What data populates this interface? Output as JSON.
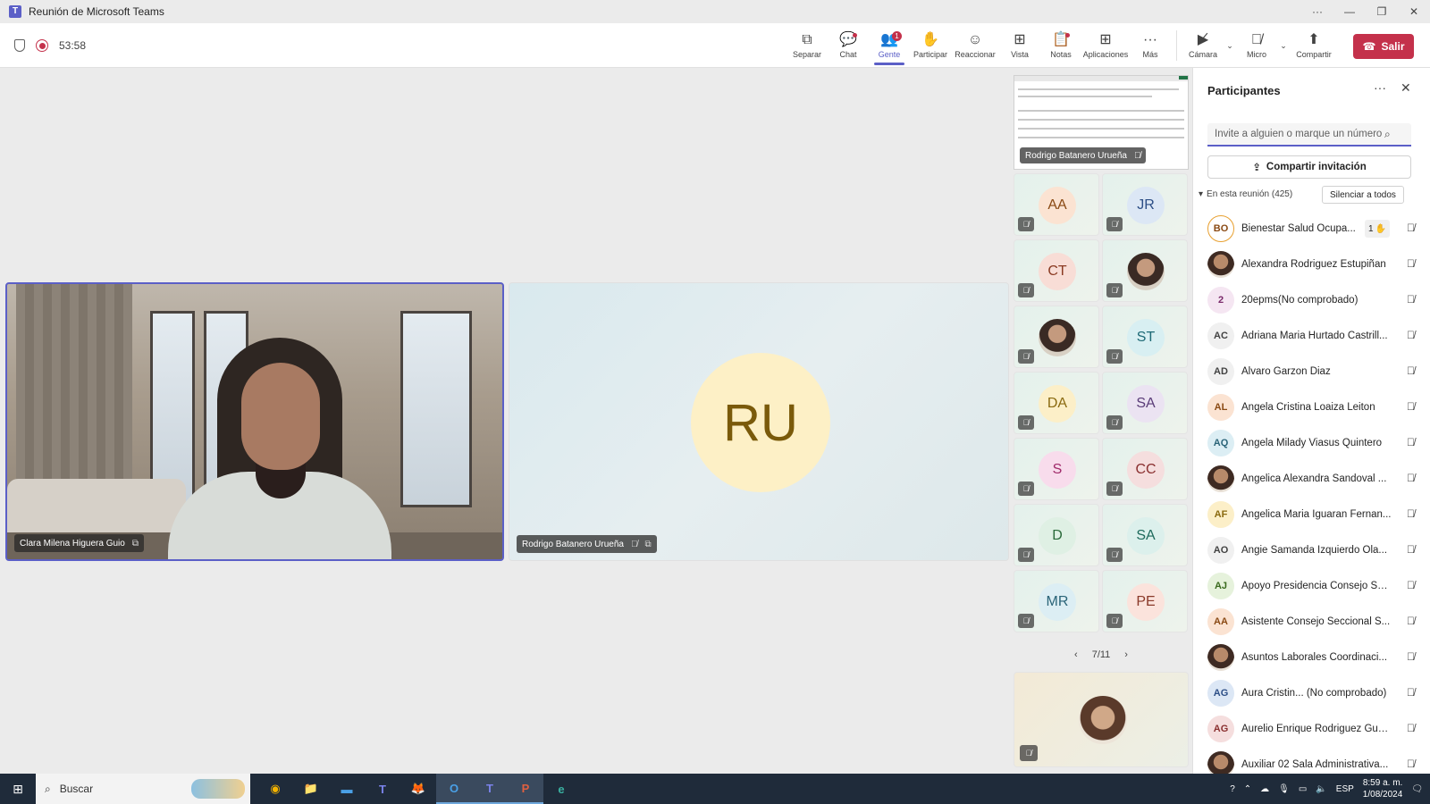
{
  "window": {
    "title": "Reunión de Microsoft Teams",
    "controls": [
      "···",
      "—",
      "❐",
      "✕"
    ]
  },
  "meeting": {
    "timer": "53:58"
  },
  "toolbar": {
    "items": [
      {
        "label": "Separar",
        "icon": "⧉"
      },
      {
        "label": "Chat",
        "icon": "💬"
      },
      {
        "label": "Gente",
        "icon": "👥",
        "badge": "1"
      },
      {
        "label": "Participar",
        "icon": "✋"
      },
      {
        "label": "Reaccionar",
        "icon": "☺"
      },
      {
        "label": "Vista",
        "icon": "⊞"
      },
      {
        "label": "Notas",
        "icon": "📋"
      },
      {
        "label": "Aplicaciones",
        "icon": "⊞"
      },
      {
        "label": "Más",
        "icon": "···"
      }
    ],
    "camera_label": "Cámara",
    "mic_label": "Micro",
    "share_label": "Compartir",
    "leave_label": "Salir"
  },
  "stage": {
    "clara_name": "Clara Milena Higuera Guio",
    "rodrigo_name": "Rodrigo Batanero Urueña",
    "rodrigo_initials": "RU"
  },
  "gallery": {
    "share_name": "Rodrigo Batanero Urueña",
    "tiles": [
      {
        "initials": "AA",
        "bg": "#fbe3d2",
        "fg": "#8a4a14"
      },
      {
        "initials": "JR",
        "bg": "#dce7f5",
        "fg": "#2c4e86"
      },
      {
        "initials": "CT",
        "bg": "#f8ddd6",
        "fg": "#8a3a22"
      },
      {
        "initials": "",
        "bg": "photo",
        "fg": ""
      },
      {
        "initials": "",
        "bg": "photo",
        "fg": ""
      },
      {
        "initials": "ST",
        "bg": "#d8eff2",
        "fg": "#1e6a76"
      },
      {
        "initials": "DA",
        "bg": "#fcefc8",
        "fg": "#8a6a10"
      },
      {
        "initials": "SA",
        "bg": "#ebe3f2",
        "fg": "#5a3c78"
      },
      {
        "initials": "S",
        "bg": "#f8dcec",
        "fg": "#a02a6a"
      },
      {
        "initials": "CC",
        "bg": "#f5dede",
        "fg": "#8a3030"
      },
      {
        "initials": "D",
        "bg": "#dff0e4",
        "fg": "#2a6a3a"
      },
      {
        "initials": "SA",
        "bg": "#dcf0ec",
        "fg": "#1e6a5c"
      },
      {
        "initials": "MR",
        "bg": "#dceef4",
        "fg": "#2a6478"
      },
      {
        "initials": "PE",
        "bg": "#fbe3dc",
        "fg": "#8a3a2a"
      }
    ],
    "pager": "7/11"
  },
  "participants": {
    "title": "Participantes",
    "search_placeholder": "Invite a alguien o marque un número",
    "invite_label": "Compartir invitación",
    "section_label": "En esta reunión (425)",
    "mute_all_label": "Silenciar a todos",
    "list": [
      {
        "initials": "BO",
        "name": "Bienestar Salud Ocupa...",
        "bg": "#fff",
        "fg": "#8a4a14",
        "hand": "1"
      },
      {
        "initials": "",
        "name": "Alexandra Rodriguez Estupiñan",
        "bg": "photo",
        "fg": ""
      },
      {
        "initials": "2",
        "name": "20epms(No comprobado)",
        "bg": "#f5e6f2",
        "fg": "#7a2a6a"
      },
      {
        "initials": "AC",
        "name": "Adriana Maria Hurtado Castrill...",
        "bg": "#f0f0f0",
        "fg": "#424242"
      },
      {
        "initials": "AD",
        "name": "Alvaro Garzon Diaz",
        "bg": "#f0f0f0",
        "fg": "#424242"
      },
      {
        "initials": "AL",
        "name": "Angela Cristina Loaiza Leiton",
        "bg": "#fbe3d2",
        "fg": "#8a4a14"
      },
      {
        "initials": "AQ",
        "name": "Angela Milady Viasus Quintero",
        "bg": "#dceef4",
        "fg": "#2a6478"
      },
      {
        "initials": "",
        "name": "Angelica Alexandra Sandoval ...",
        "bg": "photo",
        "fg": ""
      },
      {
        "initials": "AF",
        "name": "Angelica Maria Iguaran Fernan...",
        "bg": "#fcefc8",
        "fg": "#8a6a10"
      },
      {
        "initials": "AO",
        "name": "Angie Samanda Izquierdo Ola...",
        "bg": "#f0f0f0",
        "fg": "#424242"
      },
      {
        "initials": "AJ",
        "name": "Apoyo Presidencia Consejo Se...",
        "bg": "#e6f2dc",
        "fg": "#3a6a1e"
      },
      {
        "initials": "AA",
        "name": "Asistente Consejo Seccional S...",
        "bg": "#fbe3d2",
        "fg": "#8a4a14"
      },
      {
        "initials": "",
        "name": "Asuntos Laborales Coordinaci...",
        "bg": "photo",
        "fg": ""
      },
      {
        "initials": "AG",
        "name": "Aura Cristin... (No comprobado)",
        "bg": "#dce7f5",
        "fg": "#2c4e86"
      },
      {
        "initials": "AG",
        "name": "Aurelio Enrique Rodriguez Guz...",
        "bg": "#f5dede",
        "fg": "#8a3030"
      },
      {
        "initials": "",
        "name": "Auxiliar 02 Sala Administrativa...",
        "bg": "photo",
        "fg": ""
      }
    ]
  },
  "taskbar": {
    "search_label": "Buscar",
    "apps": [
      "◉",
      "📁",
      "▬",
      "T",
      "🦊",
      "O",
      "T",
      "P",
      "e"
    ],
    "tray_lang": "ESP",
    "time": "8:59 a. m.",
    "date": "1/08/2024"
  },
  "colors": {
    "accent": "#5b5fc7",
    "leave": "#c4314b"
  }
}
